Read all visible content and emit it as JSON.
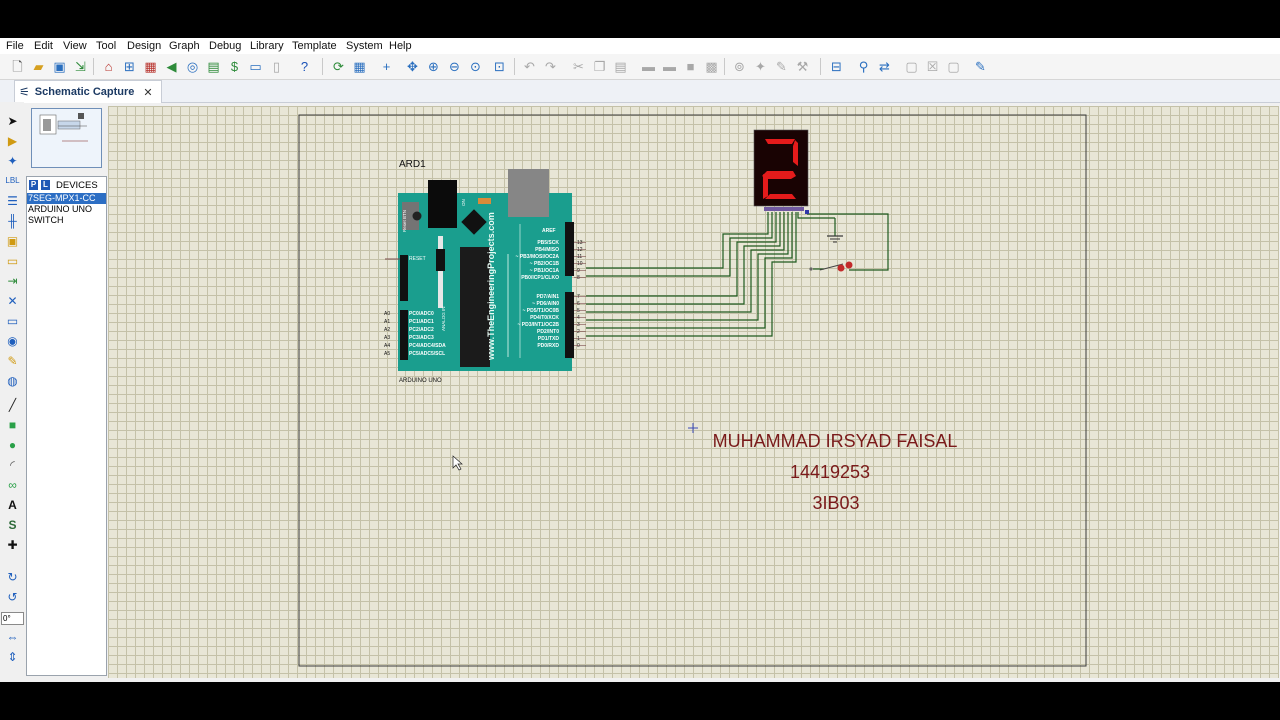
{
  "menu": [
    "File",
    "Edit",
    "View",
    "Tool",
    "Design",
    "Graph",
    "Debug",
    "Library",
    "Template",
    "System",
    "Help"
  ],
  "tab": {
    "label": "Schematic Capture",
    "close": "✕"
  },
  "devices": {
    "p": "P",
    "l": "L",
    "header": "DEVICES",
    "items": [
      "7SEG-MPX1-CC",
      "ARDUINO UNO",
      "SWITCH"
    ],
    "selected_index": 0
  },
  "rotation": "0°",
  "schematic": {
    "ard_ref": "ARD1",
    "ard_name": "ARDUINO UNO",
    "board_url": "www.TheEngineeringProjects.com",
    "reset": "RESET",
    "reset_btn": "Reset BTN",
    "on": "ON",
    "analog_in": "ANALOG IN",
    "aref": "AREF",
    "digital_pins": [
      "PB5/SCK",
      "PB4/MISO",
      "~ PB3/MOSI/OC2A",
      "~ PB2/OC1B",
      "~ PB1/OC1A",
      "PB0/ICP1/CLKO",
      "PD7/AIN1",
      "~ PD6/AIN0",
      "~ PD5/T1/OC0B",
      "PD4/T0/XCK",
      "~ PD3/INT1/OC2B",
      "PD2/INT0",
      "PD1/TXD",
      "PD0/RXD"
    ],
    "digital_nums": [
      "13",
      "12",
      "11",
      "10",
      "9",
      "8",
      "7",
      "6",
      "5",
      "4",
      "3",
      "2",
      "1",
      "0"
    ],
    "analog_pins": [
      "PC0/ADC0",
      "PC1/ADC1",
      "PC2/ADC2",
      "PC3/ADC3",
      "PC4/ADC4/SDA",
      "PC5/ADC5/SCL"
    ],
    "analog_nums": [
      "A0",
      "A1",
      "A2",
      "A3",
      "A4",
      "A5"
    ],
    "display_digit": "2",
    "text_lines": [
      "MUHAMMAD IRSYAD FAISAL",
      "14419253",
      "3IB03"
    ]
  },
  "colors": {
    "board": "#1a9e8e",
    "wire": "#1e5a1e",
    "title": "#7a1a1a",
    "segment": "#e41b1b",
    "seg_bg": "#190303",
    "canvas": "#e8e6d6",
    "grid": "#c4c1a8",
    "selection": "#2c6ec4"
  }
}
